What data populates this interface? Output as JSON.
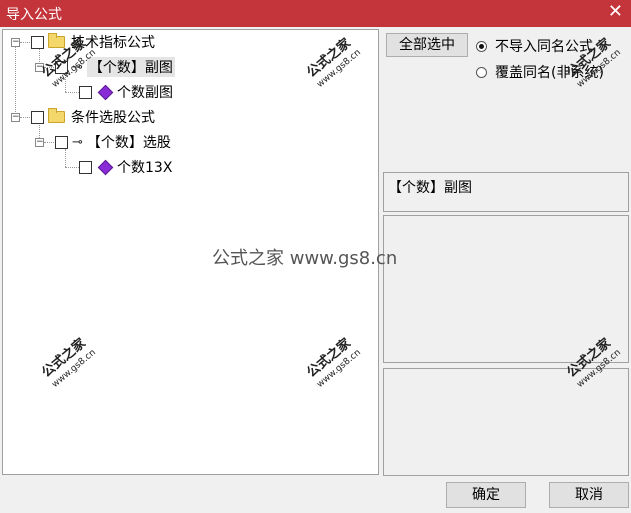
{
  "window": {
    "title": "导入公式"
  },
  "tree": {
    "items": [
      {
        "label": "技术指标公式"
      },
      {
        "label": "【个数】副图"
      },
      {
        "label": "个数副图"
      },
      {
        "label": "条件选股公式"
      },
      {
        "label": "【个数】选股"
      },
      {
        "label": "个数13X"
      }
    ]
  },
  "options": {
    "select_all_label": "全部选中",
    "radio_skip_label": "不导入同名公式",
    "radio_overwrite_label": "覆盖同名(非系统)"
  },
  "preview": {
    "name": "【个数】副图"
  },
  "watermark": {
    "brand": "公式之家",
    "url": "www.gs8.cn",
    "center_text": "公式之家 www.gs8.cn"
  },
  "buttons": {
    "ok": "确定",
    "cancel": "取消"
  }
}
